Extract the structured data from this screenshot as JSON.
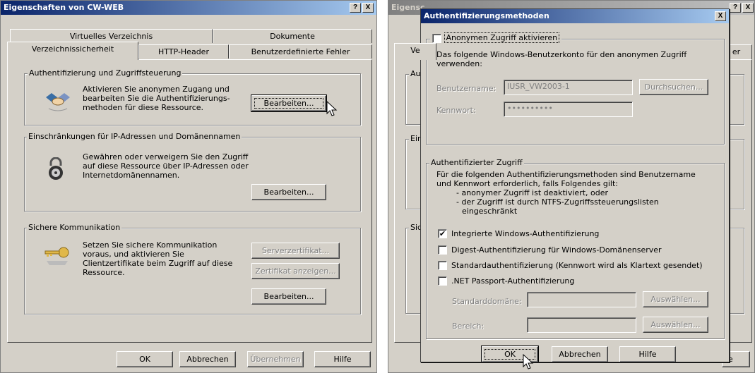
{
  "left": {
    "title": "Eigenschaften von CW-WEB",
    "help_btn": "?",
    "close_btn": "X",
    "tabs_back": [
      "Virtuelles Verzeichnis",
      "Dokumente"
    ],
    "tabs_front": [
      "Verzeichnissicherheit",
      "HTTP-Header",
      "Benutzerdefinierte Fehler"
    ],
    "auth_group": {
      "legend": "Authentifizierung und Zugriffsteuerung",
      "text": "Aktivieren Sie anonymen Zugang und bearbeiten Sie die Authentifizierungs-methoden für diese Ressource.",
      "button": "Bearbeiten..."
    },
    "ip_group": {
      "legend": "Einschränkungen für IP-Adressen und Domänennamen",
      "text": "Gewähren oder verweigern Sie den Zugriff auf diese Ressource über IP-Adressen oder Internetdomänennamen.",
      "button": "Bearbeiten..."
    },
    "secure_group": {
      "legend": "Sichere Kommunikation",
      "text": "Setzen Sie sichere Kommunikation voraus, und aktivieren Sie Clientzertifikate beim Zugriff auf diese Ressource.",
      "btn_server_cert": "Serverzertifikat...",
      "btn_view_cert": "Zertifikat anzeigen...",
      "button": "Bearbeiten..."
    },
    "footer": {
      "ok": "OK",
      "cancel": "Abbrechen",
      "apply": "Übernehmen",
      "help": "Hilfe"
    }
  },
  "right_back": {
    "title": "Eigensc",
    "help_btn": "?",
    "close_btn": "X",
    "tab_fragment_left": "Ve",
    "tab_fragment_right": "er",
    "group_fragments": [
      "Au",
      "Ein",
      "Sic"
    ],
    "footer_fragment": "fe"
  },
  "dialog": {
    "title": "Authentifizierungsmethoden",
    "close_btn": "X",
    "anon": {
      "checkbox_label": "Anonymen Zugriff aktivieren",
      "checked": false,
      "text": "Das folgende Windows-Benutzerkonto für den anonymen Zugriff verwenden:",
      "username_label": "Benutzername:",
      "username_value": "IUSR_VW2003-1",
      "browse_button": "Durchsuchen...",
      "password_label": "Kennwort:",
      "password_value": "••••••••••"
    },
    "auth": {
      "legend": "Authentifizierter Zugriff",
      "text_line1": "Für die folgenden Authentifizierungsmethoden sind Benutzername",
      "text_line2": "und Kennwort erforderlich, falls Folgendes gilt:",
      "bullet1": "- anonymer Zugriff ist deaktiviert, oder",
      "bullet2": "- der Zugriff ist durch NTFS-Zugriffssteuerungslisten",
      "bullet2b": "eingeschränkt",
      "options": [
        {
          "label": "Integrierte Windows-Authentifizierung",
          "checked": true,
          "mark": "✔"
        },
        {
          "label": "Digest-Authentifizierung für Windows-Domänenserver",
          "checked": false,
          "mark": ""
        },
        {
          "label": "Standardauthentifizierung (Kennwort wird als Klartext gesendet)",
          "checked": false,
          "mark": ""
        },
        {
          "label": ".NET Passport-Authentifizierung",
          "checked": false,
          "mark": ""
        }
      ],
      "domain_label": "Standarddomäne:",
      "realm_label": "Bereich:",
      "select_button": "Auswählen..."
    },
    "footer": {
      "ok": "OK",
      "cancel": "Abbrechen",
      "help": "Hilfe"
    }
  }
}
